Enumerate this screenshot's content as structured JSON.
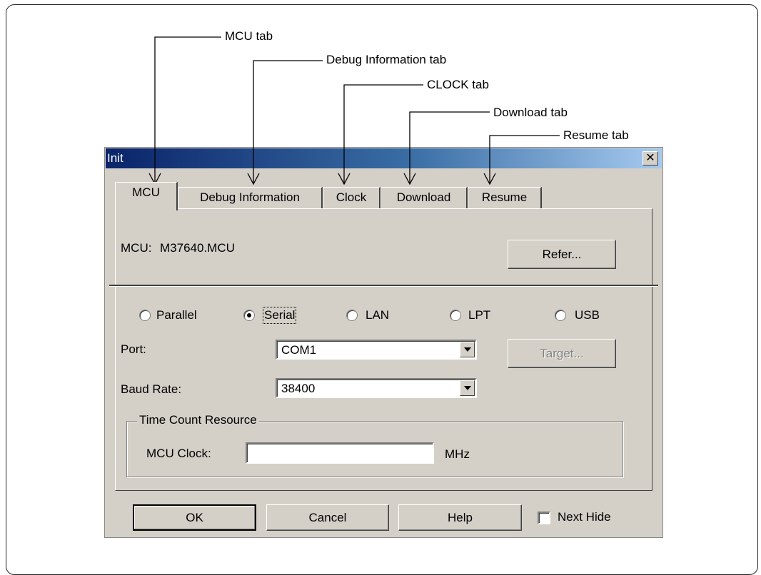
{
  "callouts": {
    "mcu_tab": "MCU tab",
    "debug_tab": "Debug Information  tab",
    "clock_tab": "CLOCK tab",
    "download_tab": "Download tab",
    "resume_tab": "Resume tab"
  },
  "window": {
    "title": "Init",
    "close_glyph": "✕"
  },
  "tabs": [
    "MCU",
    "Debug Information",
    "Clock",
    "Download",
    "Resume"
  ],
  "active_tab": "MCU",
  "mcu": {
    "label": "MCU:",
    "value": "M37640.MCU",
    "refer_button": "Refer..."
  },
  "connection": {
    "options": [
      "Parallel",
      "Serial",
      "LAN",
      "LPT",
      "USB"
    ],
    "selected": "Serial"
  },
  "port": {
    "label": "Port:",
    "value": "COM1",
    "target_button": "Target..."
  },
  "baud_rate": {
    "label": "Baud Rate:",
    "value": "38400"
  },
  "time_count": {
    "group_title": "Time Count Resource",
    "clock_label": "MCU Clock:",
    "clock_value": "",
    "unit": "MHz"
  },
  "buttons": {
    "ok": "OK",
    "cancel": "Cancel",
    "help": "Help"
  },
  "next_hide": {
    "label": "Next Hide",
    "checked": false
  },
  "colors": {
    "title_start": "#0a246a",
    "title_end": "#a6caf0",
    "face": "#d4d0c8"
  }
}
